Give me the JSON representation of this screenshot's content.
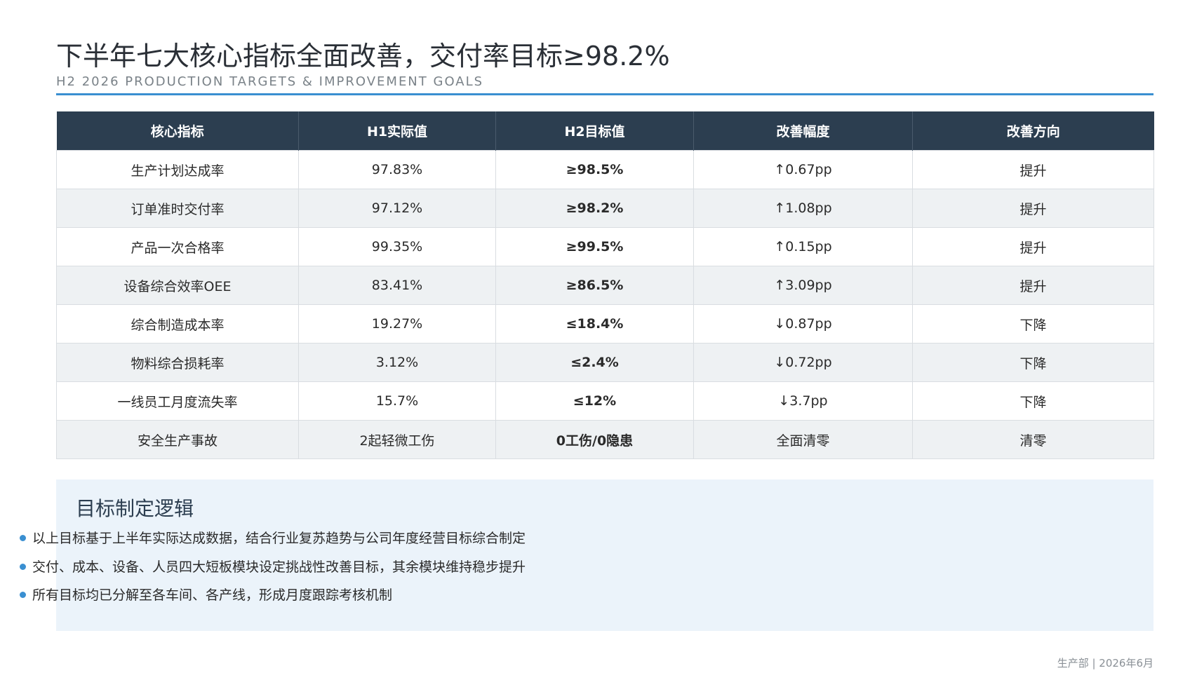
{
  "header": {
    "title": "下半年七大核心指标全面改善，交付率目标≥98.2%",
    "subtitle": "H2 2026 PRODUCTION TARGETS & IMPROVEMENT GOALS"
  },
  "table": {
    "columns": [
      "核心指标",
      "H1实际值",
      "H2目标值",
      "改善幅度",
      "改善方向"
    ],
    "rows": [
      {
        "metric": "生产计划达成率",
        "h1": "97.83%",
        "h2": "≥98.5%",
        "change": "↑0.67pp",
        "direction": "提升"
      },
      {
        "metric": "订单准时交付率",
        "h1": "97.12%",
        "h2": "≥98.2%",
        "change": "↑1.08pp",
        "direction": "提升"
      },
      {
        "metric": "产品一次合格率",
        "h1": "99.35%",
        "h2": "≥99.5%",
        "change": "↑0.15pp",
        "direction": "提升"
      },
      {
        "metric": "设备综合效率OEE",
        "h1": "83.41%",
        "h2": "≥86.5%",
        "change": "↑3.09pp",
        "direction": "提升"
      },
      {
        "metric": "综合制造成本率",
        "h1": "19.27%",
        "h2": "≤18.4%",
        "change": "↓0.87pp",
        "direction": "下降"
      },
      {
        "metric": "物料综合损耗率",
        "h1": "3.12%",
        "h2": "≤2.4%",
        "change": "↓0.72pp",
        "direction": "下降"
      },
      {
        "metric": "一线员工月度流失率",
        "h1": "15.7%",
        "h2": "≤12%",
        "change": "↓3.7pp",
        "direction": "下降"
      },
      {
        "metric": "安全生产事故",
        "h1": "2起轻微工伤",
        "h2": "0工伤/0隐患",
        "change": "全面清零",
        "direction": "清零"
      }
    ]
  },
  "logic": {
    "title": "目标制定逻辑",
    "bullets": [
      "以上目标基于上半年实际达成数据，结合行业复苏趋势与公司年度经营目标综合制定",
      "交付、成本、设备、人员四大短板模块设定挑战性改善目标，其余模块维持稳步提升",
      "所有目标均已分解至各车间、各产线，形成月度跟踪考核机制"
    ]
  },
  "footer": {
    "text": "生产部 | 2026年6月"
  },
  "colors": {
    "accent": "#3a8fd1",
    "header_bg": "#2c3e50",
    "panel_bg": "#ebf3fa"
  }
}
